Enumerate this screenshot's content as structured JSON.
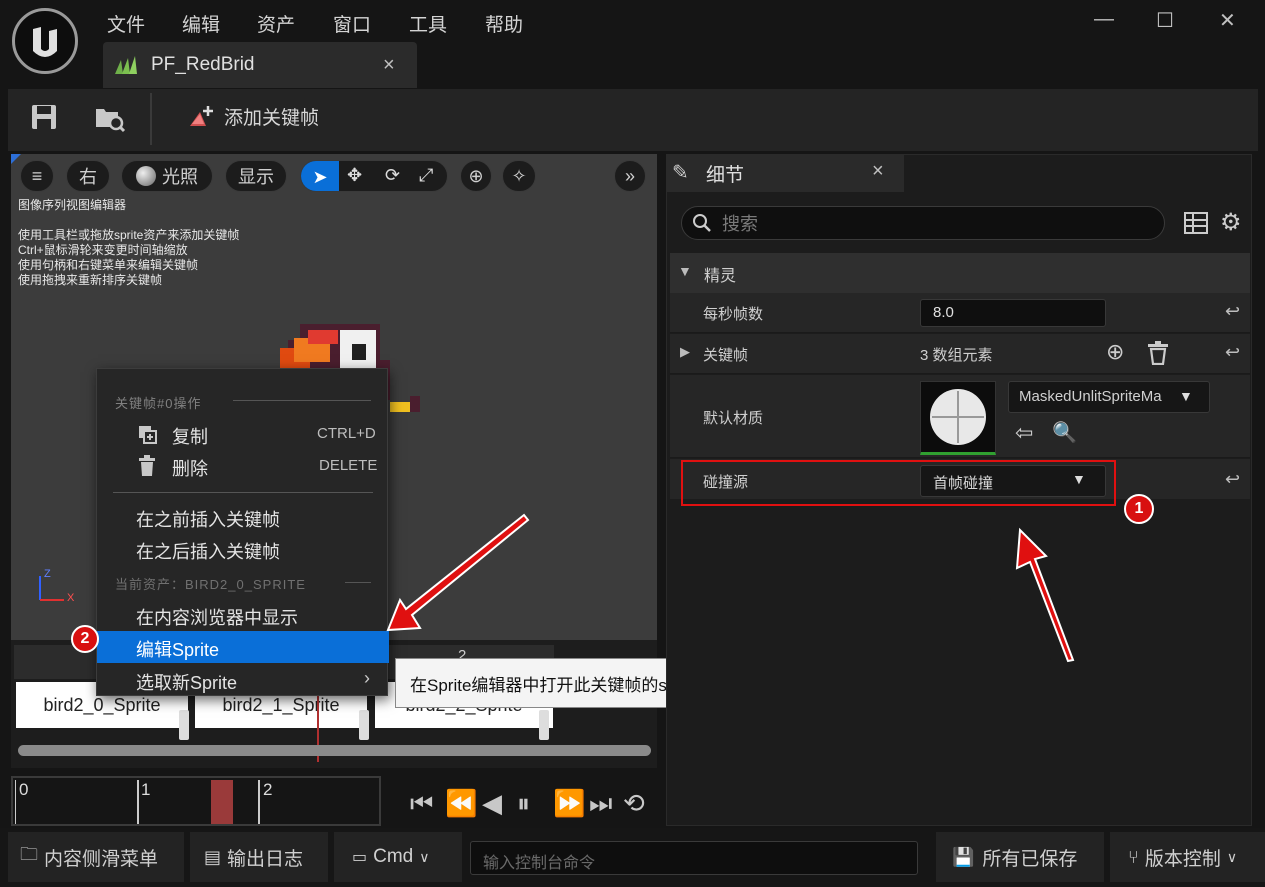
{
  "menubar": {
    "file": "文件",
    "edit": "编辑",
    "asset": "资产",
    "window": "窗口",
    "tools": "工具",
    "help": "帮助"
  },
  "window_controls": {
    "minimize": "—",
    "maximize": "☐",
    "close": "✕"
  },
  "asset_tab": {
    "title": "PF_RedBrid",
    "close": "×"
  },
  "toolbar": {
    "add_keyframe": "添加关键帧"
  },
  "viewport": {
    "view_label": "右",
    "lighting_label": "光照",
    "show_label": "显示",
    "title": "图像序列视图编辑器",
    "help_lines": [
      "使用工具栏或拖放sprite资产来添加关键帧",
      "Ctrl+鼠标滑轮来变更时间轴缩放",
      "使用句柄和右键菜单来编辑关键帧",
      "使用拖拽来重新排序关键帧"
    ],
    "axis_z": "Z",
    "axis_x": "X"
  },
  "context_menu": {
    "section1": "关键帧#0操作",
    "copy": "复制",
    "copy_shortcut": "CTRL+D",
    "delete": "删除",
    "delete_shortcut": "DELETE",
    "insert_before": "在之前插入关键帧",
    "insert_after": "在之后插入关键帧",
    "section2": "当前资产：BIRD2_0_SPRITE",
    "show_in_browser": "在内容浏览器中显示",
    "edit_sprite": "编辑Sprite",
    "pick_new_sprite": "选取新Sprite"
  },
  "tooltip": "在Sprite编辑器中打开此关键帧的sprite。",
  "annotations": {
    "badge1": "1",
    "badge2": "2"
  },
  "timeline": {
    "frames": [
      "bird2_0_Sprite",
      "bird2_1_Sprite",
      "bird2_2_Sprite"
    ],
    "frame_number": "2",
    "ruler": [
      "0",
      "1",
      "2"
    ]
  },
  "details": {
    "tab_title": "细节",
    "tab_close": "×",
    "search_placeholder": "搜索",
    "section": "精灵",
    "fps_label": "每秒帧数",
    "fps_value": "8.0",
    "keyframes_label": "关键帧",
    "keyframes_value": "3 数组元素",
    "material_label": "默认材质",
    "material_value": "MaskedUnlitSpriteMa",
    "collision_label": "碰撞源",
    "collision_value": "首帧碰撞"
  },
  "statusbar": {
    "content_drawer": "内容侧滑菜单",
    "output_log": "输出日志",
    "cmd": "Cmd",
    "console_placeholder": "输入控制台命令",
    "all_saved": "所有已保存",
    "source_control": "版本控制"
  },
  "colors": {
    "accent": "#0a6fd8",
    "highlight_red": "#e01010",
    "playhead": "#b03030"
  }
}
